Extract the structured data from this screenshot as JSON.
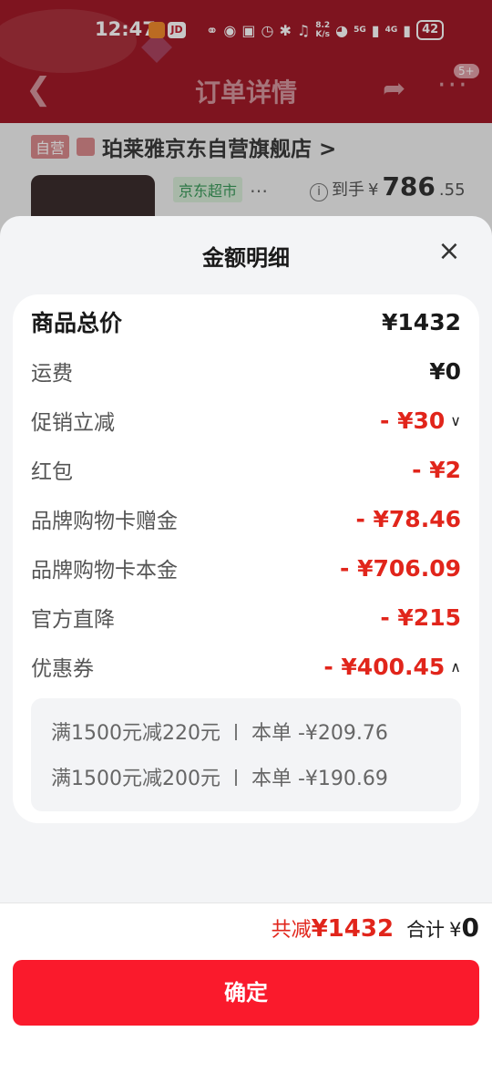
{
  "status_bar": {
    "time": "12:47",
    "app_badge": "JD",
    "speed_value": "8.2",
    "speed_unit": "K/s",
    "signal_5g": "5G",
    "signal_4g": "4G",
    "battery": "42"
  },
  "nav": {
    "title": "订单详情",
    "badge": "5+"
  },
  "store": {
    "tag": "自营",
    "name": "珀莱雅京东自营旗舰店 >"
  },
  "product": {
    "supermarket_tag": "京东超市",
    "ellipsis": "…",
    "price_label": "到手",
    "price_currency": "¥",
    "price_int": "786",
    "price_dec": ".55"
  },
  "sheet": {
    "title": "金额明细",
    "rows": [
      {
        "label": "商品总价",
        "value": "¥1432"
      },
      {
        "label": "运费",
        "value": "¥0"
      },
      {
        "label": "促销立减",
        "value": "- ¥30"
      },
      {
        "label": "红包",
        "value": "- ¥2"
      },
      {
        "label": "品牌购物卡赠金",
        "value": "- ¥78.46"
      },
      {
        "label": "品牌购物卡本金",
        "value": "- ¥706.09"
      },
      {
        "label": "官方直降",
        "value": "- ¥215"
      },
      {
        "label": "优惠券",
        "value": "- ¥400.45"
      }
    ],
    "coupons": [
      {
        "rule": "满1500元减220元",
        "detail": "本单 -¥209.76"
      },
      {
        "rule": "满1500元减200元",
        "detail": "本单 -¥190.69"
      }
    ]
  },
  "footer": {
    "reduce_label": "共减",
    "reduce_value": "¥1432",
    "total_label": "合计",
    "total_currency": "¥",
    "total_value": "0",
    "confirm_label": "确定"
  },
  "colors": {
    "accent_red": "#e1251b",
    "button_red": "#fa1a2c",
    "header_red": "#a21a28"
  }
}
